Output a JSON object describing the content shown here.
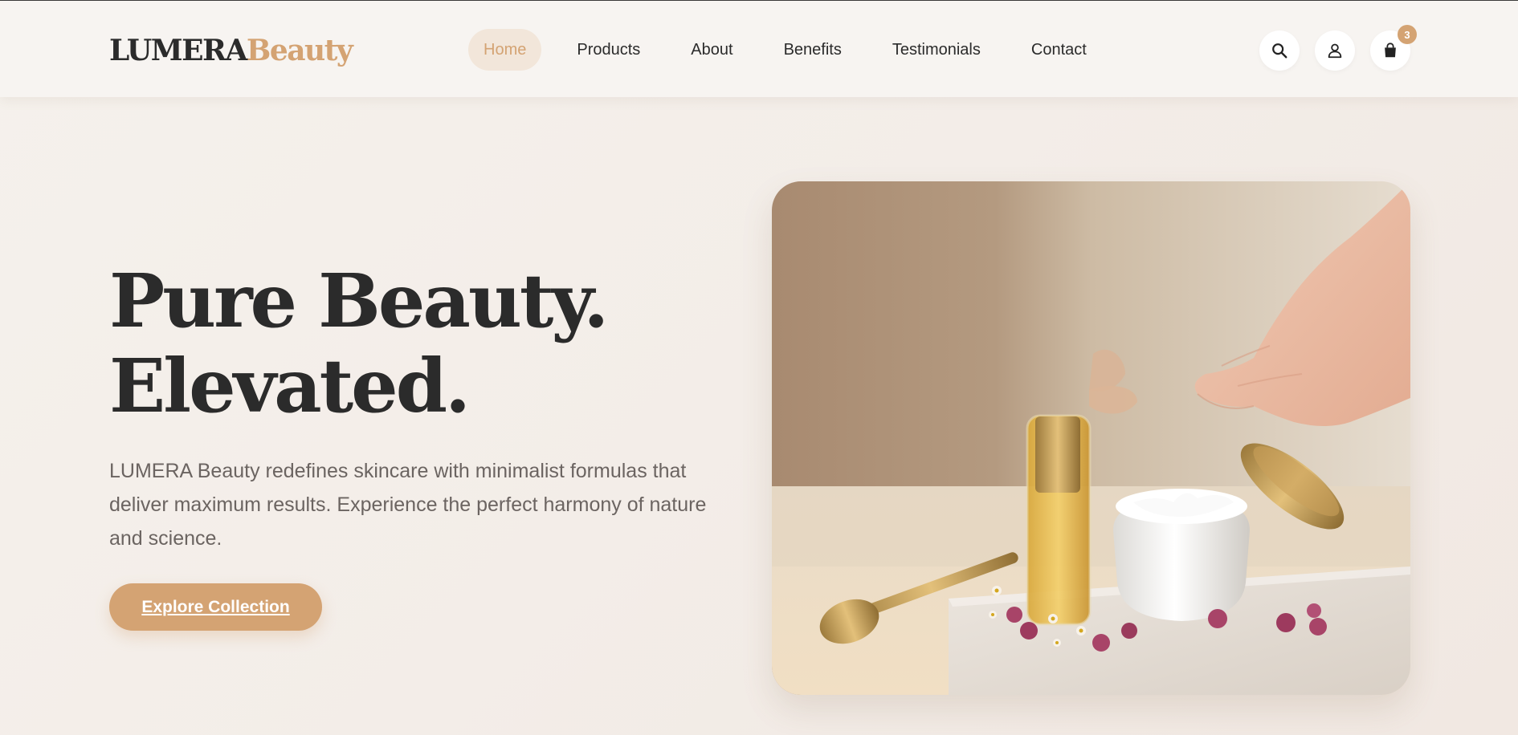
{
  "brand": {
    "name_primary": "LUMERA",
    "name_secondary": "Beauty"
  },
  "nav": {
    "items": [
      {
        "label": "Home",
        "active": true
      },
      {
        "label": "Products"
      },
      {
        "label": "About"
      },
      {
        "label": "Benefits"
      },
      {
        "label": "Testimonials"
      },
      {
        "label": "Contact"
      }
    ]
  },
  "header_actions": {
    "search_icon": "search-icon",
    "account_icon": "user-icon",
    "cart_icon": "shopping-bag-icon",
    "cart_count": "3"
  },
  "hero": {
    "title_line1": "Pure Beauty.",
    "title_line2": "Elevated.",
    "description": "LUMERA Beauty redefines skincare with minimalist formulas that deliver maximum results. Experience the perfect harmony of nature and science.",
    "cta_label": "Explore Collection"
  },
  "colors": {
    "accent": "#d4a373",
    "text_dark": "#2b2b2b",
    "text_muted": "#6b6461",
    "background": "#f5f1ec"
  }
}
